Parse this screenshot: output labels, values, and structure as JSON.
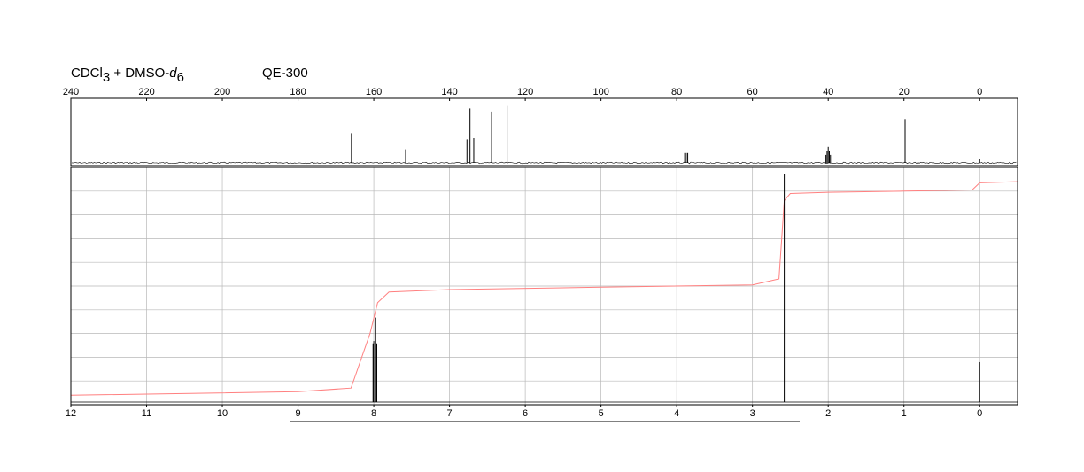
{
  "header": {
    "solvent_prefix": "CDCl",
    "solvent_sub": "3",
    "solvent_mid": " + DMSO-",
    "solvent_d": "d",
    "solvent_d_sub": "6",
    "instrument": "QE-300"
  },
  "colors": {
    "axis": "#000000",
    "grid": "#b8b8b8",
    "spectrum": "#000000",
    "integral": "#ff8080"
  },
  "chart_data": [
    {
      "type": "line",
      "title": "",
      "nucleus": "13C",
      "x_reversed": true,
      "xlim": [
        240,
        -10
      ],
      "x_ticks": [
        240,
        220,
        200,
        180,
        160,
        140,
        120,
        100,
        80,
        60,
        40,
        20,
        0
      ],
      "grid": false,
      "series": [
        {
          "peaks": [
            {
              "x": 165.9,
              "h": 0.48
            },
            {
              "x": 151.6,
              "h": 0.22
            },
            {
              "x": 135.4,
              "h": 0.38
            },
            {
              "x": 134.6,
              "h": 0.88
            },
            {
              "x": 133.6,
              "h": 0.4
            },
            {
              "x": 128.9,
              "h": 0.83
            },
            {
              "x": 124.8,
              "h": 0.92
            },
            {
              "x": 77.9,
              "h": 0.16
            },
            {
              "x": 77.5,
              "h": 0.16
            },
            {
              "x": 77.1,
              "h": 0.16
            },
            {
              "x": 40.6,
              "h": 0.13
            },
            {
              "x": 40.3,
              "h": 0.2
            },
            {
              "x": 40.0,
              "h": 0.26
            },
            {
              "x": 39.7,
              "h": 0.2
            },
            {
              "x": 39.4,
              "h": 0.13
            },
            {
              "x": 19.7,
              "h": 0.71
            },
            {
              "x": 0.0,
              "h": 0.07
            }
          ]
        }
      ]
    },
    {
      "type": "line",
      "title": "",
      "nucleus": "1H",
      "x_reversed": true,
      "xlim": [
        12,
        -0.5
      ],
      "x_ticks": [
        12,
        11,
        10,
        9,
        8,
        7,
        6,
        5,
        4,
        3,
        2,
        1,
        0
      ],
      "grid": true,
      "series": [
        {
          "peaks": [
            {
              "x": 8.01,
              "h": 0.25
            },
            {
              "x": 8.0,
              "h": 0.26
            },
            {
              "x": 7.98,
              "h": 0.36
            },
            {
              "x": 7.96,
              "h": 0.25
            },
            {
              "x": 2.58,
              "h": 0.97
            },
            {
              "x": 0.0,
              "h": 0.17
            }
          ]
        }
      ],
      "integral": [
        {
          "x": 12.0,
          "y": 0.04
        },
        {
          "x": 9.0,
          "y": 0.055
        },
        {
          "x": 8.3,
          "y": 0.07
        },
        {
          "x": 8.05,
          "y": 0.3
        },
        {
          "x": 7.95,
          "y": 0.43
        },
        {
          "x": 7.8,
          "y": 0.475
        },
        {
          "x": 7.0,
          "y": 0.485
        },
        {
          "x": 5.0,
          "y": 0.495
        },
        {
          "x": 3.0,
          "y": 0.505
        },
        {
          "x": 2.65,
          "y": 0.53
        },
        {
          "x": 2.58,
          "y": 0.86
        },
        {
          "x": 2.5,
          "y": 0.89
        },
        {
          "x": 2.0,
          "y": 0.895
        },
        {
          "x": 1.0,
          "y": 0.9
        },
        {
          "x": 0.1,
          "y": 0.905
        },
        {
          "x": 0.0,
          "y": 0.935
        },
        {
          "x": -0.5,
          "y": 0.94
        }
      ]
    }
  ]
}
